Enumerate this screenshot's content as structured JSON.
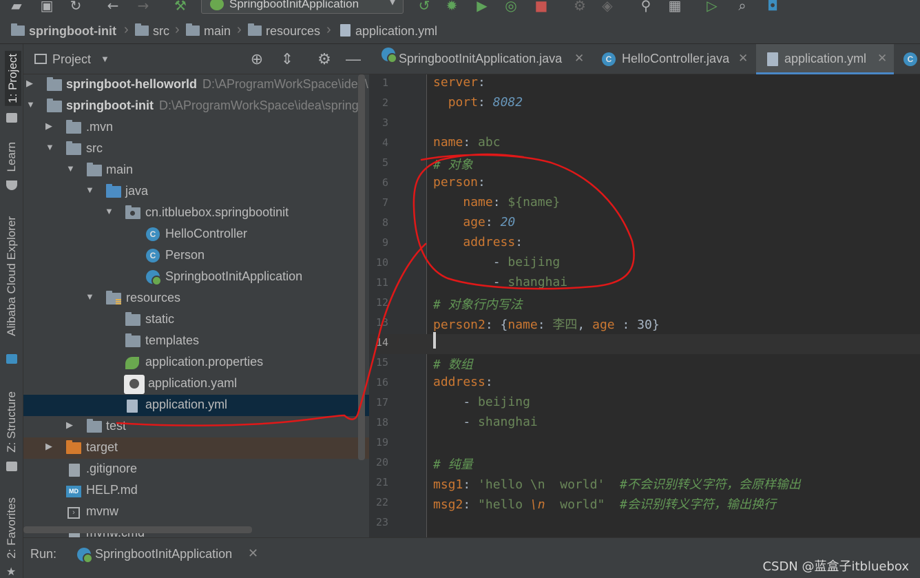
{
  "toolbar": {
    "run_config": "SpringbootInitApplication"
  },
  "breadcrumb": {
    "items": [
      "springboot-init",
      "src",
      "main",
      "resources",
      "application.yml"
    ]
  },
  "left_stripe": {
    "tabs": [
      "1: Project",
      "Learn",
      "Alibaba Cloud Explorer",
      "Z: Structure",
      "2: Favorites"
    ]
  },
  "project_panel": {
    "title": "Project",
    "tree": [
      {
        "label": "springboot-helloworld",
        "path": "D:\\AProgramWorkSpace\\idea\\",
        "bold": true
      },
      {
        "label": "springboot-init",
        "path": "D:\\AProgramWorkSpace\\idea\\springb",
        "bold": true
      },
      {
        "label": ".mvn"
      },
      {
        "label": "src"
      },
      {
        "label": "main"
      },
      {
        "label": "java"
      },
      {
        "label": "cn.itbluebox.springbootinit"
      },
      {
        "label": "HelloController"
      },
      {
        "label": "Person"
      },
      {
        "label": "SpringbootInitApplication"
      },
      {
        "label": "resources"
      },
      {
        "label": "static"
      },
      {
        "label": "templates"
      },
      {
        "label": "application.properties"
      },
      {
        "label": "application.yaml"
      },
      {
        "label": "application.yml"
      },
      {
        "label": "test"
      },
      {
        "label": "target"
      },
      {
        "label": ".gitignore"
      },
      {
        "label": "HELP.md"
      },
      {
        "label": "mvnw"
      },
      {
        "label": "mvnw.cmd"
      }
    ]
  },
  "editor_tabs": {
    "items": [
      "SpringbootInitApplication.java",
      "HelloController.java",
      "application.yml"
    ]
  },
  "editor": {
    "line_numbers": [
      "1",
      "2",
      "3",
      "4",
      "5",
      "6",
      "7",
      "8",
      "9",
      "10",
      "11",
      "12",
      "13",
      "14",
      "15",
      "16",
      "17",
      "18",
      "19",
      "20",
      "21",
      "22",
      "23"
    ],
    "tokens": {
      "l1_key": "server",
      "l2_key": "port",
      "l2_val": "8082",
      "l4_key": "name",
      "l4_val": "abc",
      "l5_comment": "# 对象",
      "l6_key": "person",
      "l7_key": "name",
      "l7_val": "${name}",
      "l8_key": "age",
      "l8_val": "20",
      "l9_key": "address",
      "l10_val": "beijing",
      "l11_val": "shanghai",
      "l12_comment": "# 对象行内写法",
      "l13_key": "person2",
      "l13_k1": "name",
      "l13_v1": "李四",
      "l13_k2": "age",
      "l13_v2": "30",
      "l15_comment": "# 数组",
      "l16_key": "address",
      "l17_val": "beijing",
      "l18_val": "shanghai",
      "l20_comment": "# 纯量",
      "l21_key": "msg1",
      "l21_val": "'hello \\n  world'",
      "l21_comment": "#不会识别转义字符，会原样输出",
      "l22_key": "msg2",
      "l22_val_a": "\"hello ",
      "l22_esc": "\\n",
      "l22_val_b": "  world\"",
      "l22_comment": "#会识别转义字符，输出换行"
    }
  },
  "run_bar": {
    "label": "Run:",
    "tab": "SpringbootInitApplication"
  },
  "watermark": "CSDN @蓝盒子itbluebox",
  "colors": {
    "background": "#2b2b2b",
    "panel": "#3c3f41",
    "keyword": "#cc7832",
    "string": "#6a8759",
    "number": "#6897bb",
    "comment": "#629755",
    "selection": "#0d293e",
    "annotation": "#e01818"
  }
}
